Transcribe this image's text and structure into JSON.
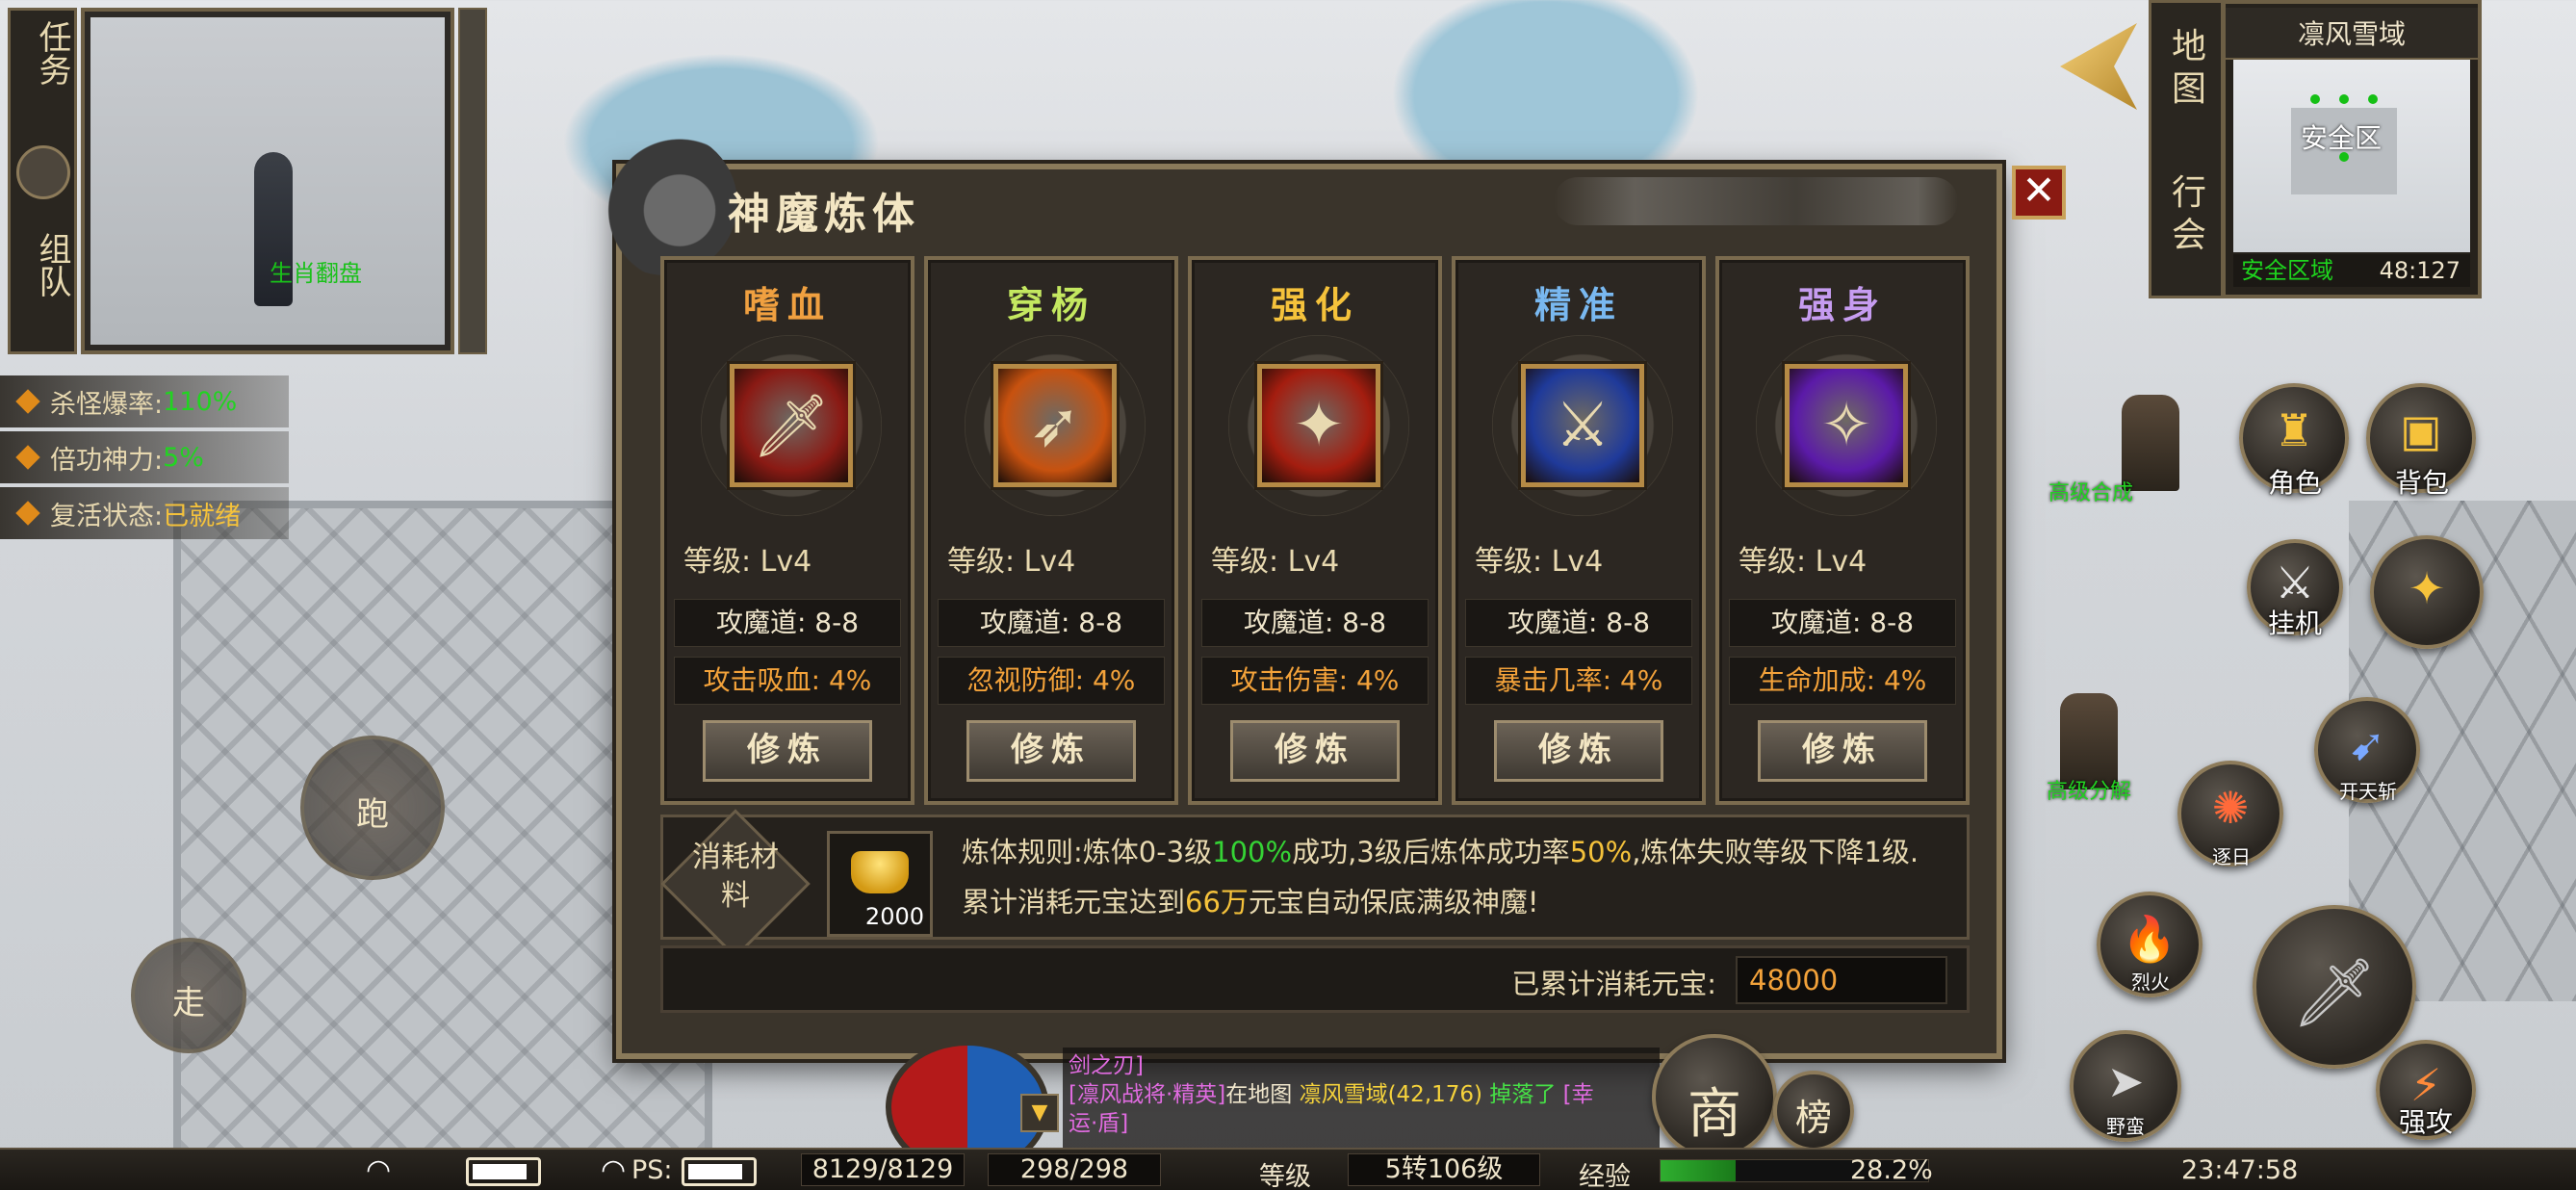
{
  "left_panel": {
    "tabs": [
      {
        "label": "任务"
      },
      {
        "label": "组队"
      }
    ],
    "npc_name": "生肖翻盘",
    "stats": [
      {
        "label": "杀怪爆率:",
        "value": "110%"
      },
      {
        "label": "倍功神力:",
        "value": "5%"
      },
      {
        "label": "复活状态:",
        "value": "已就绪"
      }
    ]
  },
  "dialog": {
    "title": "神魔炼体",
    "close_glyph": "✕",
    "cards": [
      {
        "name": "嗜血",
        "title_color": "#f0a040",
        "icon_bg": "#8a1a14",
        "icon_glyph": "🗡",
        "level": "等级: Lv4",
        "attr1": "攻魔道: 8-8",
        "attr2": "攻击吸血: 4%",
        "button": "修炼"
      },
      {
        "name": "穿杨",
        "title_color": "#c4e860",
        "icon_bg": "#c8520f",
        "icon_glyph": "➶",
        "level": "等级: Lv4",
        "attr1": "攻魔道: 8-8",
        "attr2": "忽视防御: 4%",
        "button": "修炼"
      },
      {
        "name": "强化",
        "title_color": "#f5c23b",
        "icon_bg": "#a41d0f",
        "icon_glyph": "✦",
        "level": "等级: Lv4",
        "attr1": "攻魔道: 8-8",
        "attr2": "攻击伤害: 4%",
        "button": "修炼"
      },
      {
        "name": "精准",
        "title_color": "#79b8f0",
        "icon_bg": "#1f3a9a",
        "icon_glyph": "⚔",
        "level": "等级: Lv4",
        "attr1": "攻魔道: 8-8",
        "attr2": "暴击几率: 4%",
        "button": "修炼"
      },
      {
        "name": "强身",
        "title_color": "#c69cf0",
        "icon_bg": "#5b1aa8",
        "icon_glyph": "✧",
        "level": "等级: Lv4",
        "attr1": "攻魔道: 8-8",
        "attr2": "生命加成: 4%",
        "button": "修炼"
      }
    ],
    "consume_label": "消耗材料",
    "consume_amount": "2000",
    "rule": {
      "p1": "炼体规则:炼体0-3级",
      "p2": "100%",
      "p3": "成功,3级后炼体成功率",
      "p4": "50%",
      "p5": ",炼体失败等级下降1级. 累计消耗元宝达到",
      "p6": "66万",
      "p7": "元宝自动保底满级神魔!"
    },
    "total_label": "已累计消耗元宝:",
    "total_value": "48000"
  },
  "minimap": {
    "tabs": [
      {
        "label": "地图"
      },
      {
        "label": "行会"
      }
    ],
    "title": "凛风雪域",
    "safe_label": "安全区",
    "zone": "安全区域",
    "coords": "48:127"
  },
  "right_buttons": {
    "character": "角色",
    "bag": "背包",
    "auto": "挂机",
    "npc_synthesis": "高级合成",
    "npc_decompose": "高级分解",
    "skills": [
      {
        "label": "开天斩"
      },
      {
        "label": "逐日"
      },
      {
        "label": "烈火"
      },
      {
        "label": "野蛮"
      },
      {
        "label": "强攻"
      }
    ]
  },
  "joystick": {
    "run": "跑",
    "walk": "走"
  },
  "chat": {
    "line1": "剑之刃]",
    "line2_a": "[凛风战将·精英]",
    "line2_b": "在地图",
    "line2_c": "凛风雪域(42,176)",
    "line2_d": "掉落了",
    "line2_e": "[幸",
    "line3": "运·盾]"
  },
  "shop_glyph": "商",
  "rank_glyph": "榜",
  "status": {
    "ps": "PS:",
    "hp": "8129/8129",
    "mp": "298/298",
    "level_label": "等级",
    "level_value": "5转106级",
    "exp_label": "经验",
    "exp_percent": "28.2%",
    "exp_fraction": 0.282,
    "time": "23:47:58"
  }
}
